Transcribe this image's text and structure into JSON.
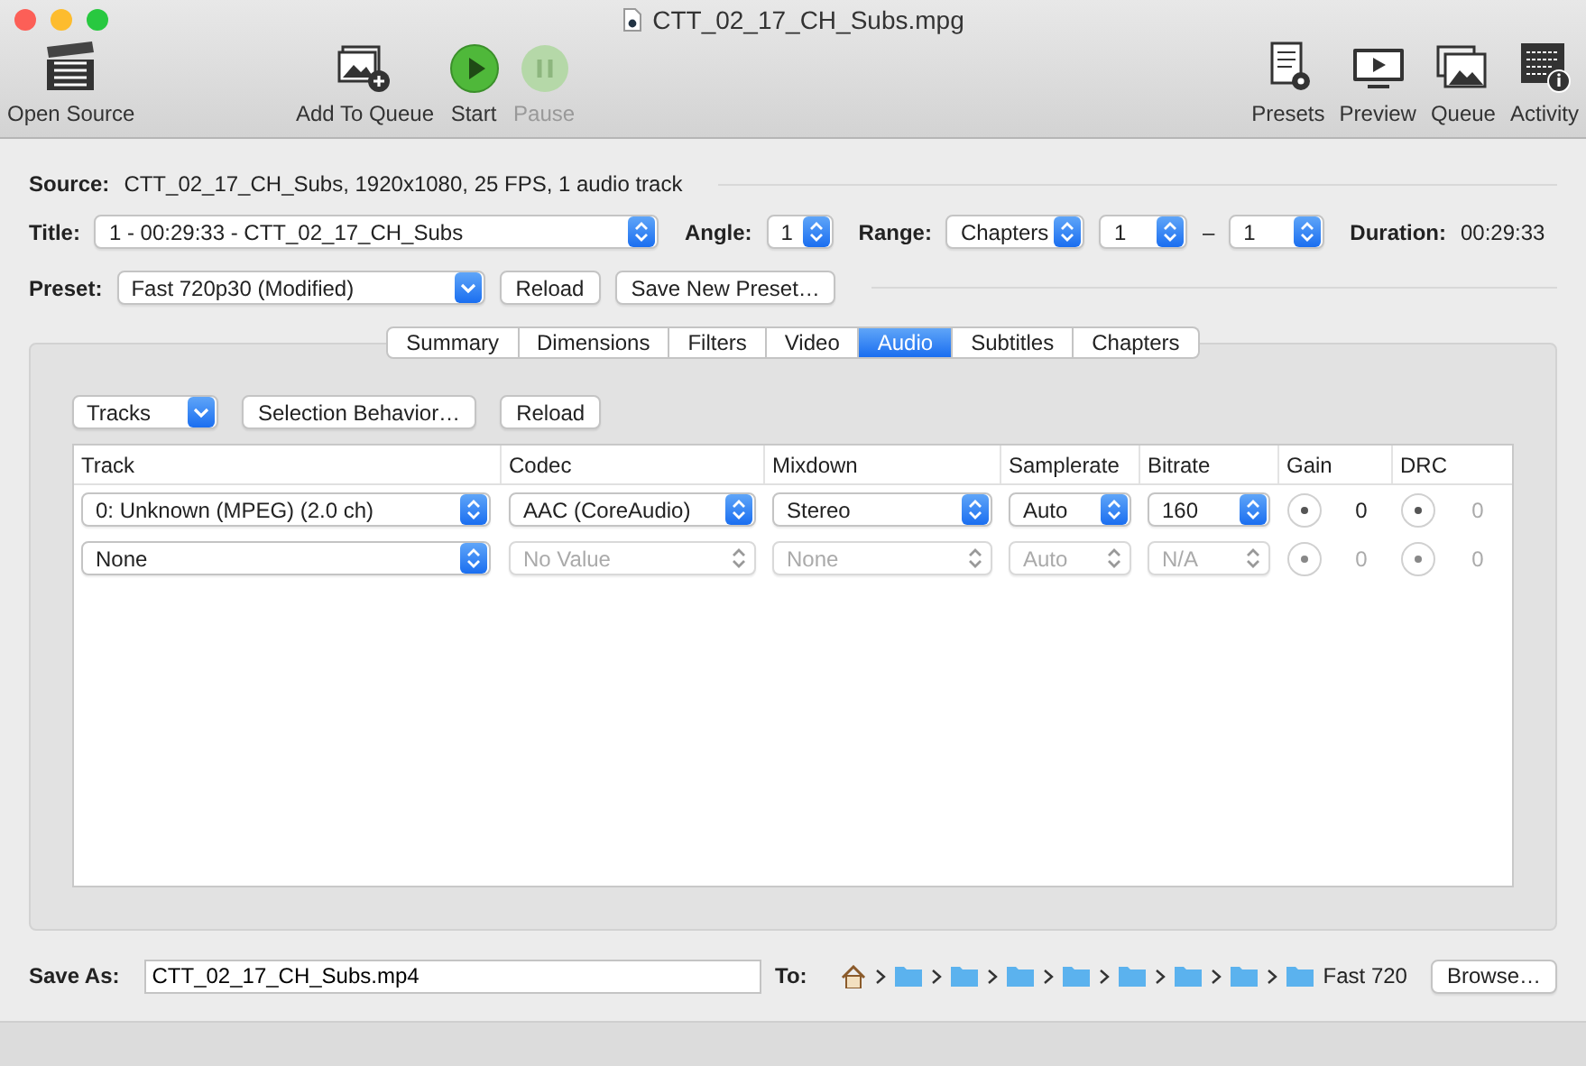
{
  "window": {
    "title": "CTT_02_17_CH_Subs.mpg"
  },
  "toolbar": {
    "left": [
      {
        "label": "Open Source",
        "kind": "clapper",
        "disabled": false
      },
      {
        "label": "Add To Queue",
        "kind": "add",
        "disabled": false
      },
      {
        "label": "Start",
        "kind": "play",
        "disabled": false
      },
      {
        "label": "Pause",
        "kind": "pause",
        "disabled": true
      }
    ],
    "right": [
      {
        "label": "Presets",
        "kind": "presets",
        "disabled": false
      },
      {
        "label": "Preview",
        "kind": "preview",
        "disabled": false
      },
      {
        "label": "Queue",
        "kind": "queue",
        "disabled": false
      },
      {
        "label": "Activity",
        "kind": "activity",
        "disabled": false
      }
    ]
  },
  "source": {
    "label": "Source:",
    "value": "CTT_02_17_CH_Subs, 1920x1080, 25 FPS, 1 audio track"
  },
  "title_row": {
    "title": {
      "label": "Title:",
      "value": "1 - 00:29:33 - CTT_02_17_CH_Subs"
    },
    "angle": {
      "label": "Angle:",
      "value": "1"
    },
    "range": {
      "label": "Range:",
      "mode": "Chapters",
      "from": "1",
      "dash": "–",
      "to": "1"
    },
    "duration": {
      "label": "Duration:",
      "value": "00:29:33"
    }
  },
  "preset": {
    "label": "Preset:",
    "value": "Fast 720p30 (Modified)",
    "buttons": [
      "Reload",
      "Save New Preset…"
    ]
  },
  "tabs": [
    {
      "label": "Summary",
      "selected": false
    },
    {
      "label": "Dimensions",
      "selected": false
    },
    {
      "label": "Filters",
      "selected": false
    },
    {
      "label": "Video",
      "selected": false
    },
    {
      "label": "Audio",
      "selected": true
    },
    {
      "label": "Subtitles",
      "selected": false
    },
    {
      "label": "Chapters",
      "selected": false
    }
  ],
  "audio": {
    "selector": "Tracks",
    "buttons": [
      "Selection Behavior…",
      "Reload"
    ],
    "columns": [
      "Track",
      "Codec",
      "Mixdown",
      "Samplerate",
      "Bitrate",
      "Gain",
      "DRC"
    ],
    "rows": [
      {
        "track": "0: Unknown (MPEG) (2.0 ch)",
        "codec": "AAC (CoreAudio)",
        "mixdown": "Stereo",
        "samplerate": "Auto",
        "bitrate": "160",
        "gain": "0",
        "drc": "0",
        "disabled": false
      },
      {
        "track": "None",
        "codec": "No Value",
        "mixdown": "None",
        "samplerate": "Auto",
        "bitrate": "N/A",
        "gain": "0",
        "drc": "0",
        "disabled": true
      }
    ]
  },
  "save": {
    "label": "Save As:",
    "value": "CTT_02_17_CH_Subs.mp4"
  },
  "destination": {
    "label": "To:",
    "path": [
      {
        "kind": "home"
      },
      {
        "kind": "folder"
      },
      {
        "kind": "folder"
      },
      {
        "kind": "folder"
      },
      {
        "kind": "folder"
      },
      {
        "kind": "folder"
      },
      {
        "kind": "folder"
      },
      {
        "kind": "folder"
      },
      {
        "kind": "folder",
        "label": "Fast 720"
      }
    ],
    "button": "Browse…"
  }
}
